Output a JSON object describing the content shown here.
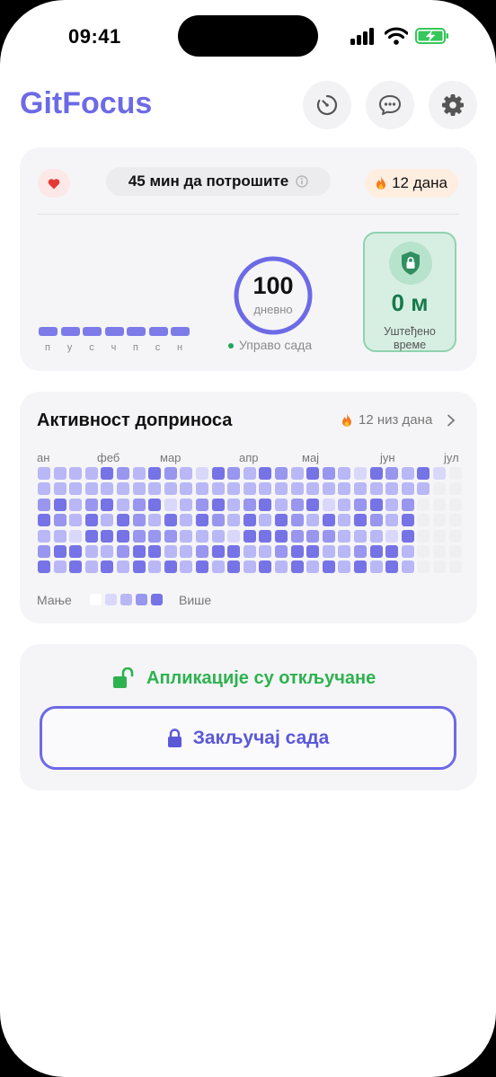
{
  "status_bar": {
    "time": "09:41"
  },
  "header": {
    "title": "GitFocus",
    "icons": [
      "timer-icon",
      "chat-icon",
      "gear-icon"
    ]
  },
  "focus_card": {
    "heart_icon": "heart-icon",
    "time_left": "45 мин да потрошите",
    "streak": "12 дана",
    "weekday_labels": [
      "п",
      "у",
      "с",
      "ч",
      "п",
      "с",
      "н"
    ],
    "ring_value": "100",
    "ring_unit": "дневно",
    "now_label": "Управо сада",
    "saved_value": "0 м",
    "saved_label_1": "Уштеђено",
    "saved_label_2": "време"
  },
  "activity": {
    "title": "Активност доприноса",
    "streak": "12 низ дана",
    "months": [
      "ан",
      "феб",
      "мар",
      "апр",
      "мај",
      "јун",
      "јул"
    ],
    "legend_less": "Мање",
    "legend_more": "Више",
    "colors": [
      "#efeff2",
      "#d9d8fb",
      "#b9b7f6",
      "#9896ee",
      "#7673e6"
    ]
  },
  "lock_card": {
    "status": "Апликације су откључане",
    "button_label": "Закључај сада"
  },
  "colors": {
    "accent": "#6d6ae6",
    "green": "#2db24f",
    "card": "#f5f5f7"
  }
}
